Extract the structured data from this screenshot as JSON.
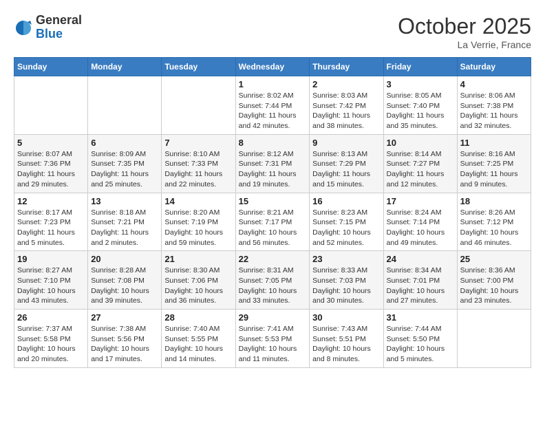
{
  "header": {
    "logo_general": "General",
    "logo_blue": "Blue",
    "month": "October 2025",
    "location": "La Verrie, France"
  },
  "weekdays": [
    "Sunday",
    "Monday",
    "Tuesday",
    "Wednesday",
    "Thursday",
    "Friday",
    "Saturday"
  ],
  "weeks": [
    [
      {
        "day": "",
        "info": ""
      },
      {
        "day": "",
        "info": ""
      },
      {
        "day": "",
        "info": ""
      },
      {
        "day": "1",
        "info": "Sunrise: 8:02 AM\nSunset: 7:44 PM\nDaylight: 11 hours and 42 minutes."
      },
      {
        "day": "2",
        "info": "Sunrise: 8:03 AM\nSunset: 7:42 PM\nDaylight: 11 hours and 38 minutes."
      },
      {
        "day": "3",
        "info": "Sunrise: 8:05 AM\nSunset: 7:40 PM\nDaylight: 11 hours and 35 minutes."
      },
      {
        "day": "4",
        "info": "Sunrise: 8:06 AM\nSunset: 7:38 PM\nDaylight: 11 hours and 32 minutes."
      }
    ],
    [
      {
        "day": "5",
        "info": "Sunrise: 8:07 AM\nSunset: 7:36 PM\nDaylight: 11 hours and 29 minutes."
      },
      {
        "day": "6",
        "info": "Sunrise: 8:09 AM\nSunset: 7:35 PM\nDaylight: 11 hours and 25 minutes."
      },
      {
        "day": "7",
        "info": "Sunrise: 8:10 AM\nSunset: 7:33 PM\nDaylight: 11 hours and 22 minutes."
      },
      {
        "day": "8",
        "info": "Sunrise: 8:12 AM\nSunset: 7:31 PM\nDaylight: 11 hours and 19 minutes."
      },
      {
        "day": "9",
        "info": "Sunrise: 8:13 AM\nSunset: 7:29 PM\nDaylight: 11 hours and 15 minutes."
      },
      {
        "day": "10",
        "info": "Sunrise: 8:14 AM\nSunset: 7:27 PM\nDaylight: 11 hours and 12 minutes."
      },
      {
        "day": "11",
        "info": "Sunrise: 8:16 AM\nSunset: 7:25 PM\nDaylight: 11 hours and 9 minutes."
      }
    ],
    [
      {
        "day": "12",
        "info": "Sunrise: 8:17 AM\nSunset: 7:23 PM\nDaylight: 11 hours and 5 minutes."
      },
      {
        "day": "13",
        "info": "Sunrise: 8:18 AM\nSunset: 7:21 PM\nDaylight: 11 hours and 2 minutes."
      },
      {
        "day": "14",
        "info": "Sunrise: 8:20 AM\nSunset: 7:19 PM\nDaylight: 10 hours and 59 minutes."
      },
      {
        "day": "15",
        "info": "Sunrise: 8:21 AM\nSunset: 7:17 PM\nDaylight: 10 hours and 56 minutes."
      },
      {
        "day": "16",
        "info": "Sunrise: 8:23 AM\nSunset: 7:15 PM\nDaylight: 10 hours and 52 minutes."
      },
      {
        "day": "17",
        "info": "Sunrise: 8:24 AM\nSunset: 7:14 PM\nDaylight: 10 hours and 49 minutes."
      },
      {
        "day": "18",
        "info": "Sunrise: 8:26 AM\nSunset: 7:12 PM\nDaylight: 10 hours and 46 minutes."
      }
    ],
    [
      {
        "day": "19",
        "info": "Sunrise: 8:27 AM\nSunset: 7:10 PM\nDaylight: 10 hours and 43 minutes."
      },
      {
        "day": "20",
        "info": "Sunrise: 8:28 AM\nSunset: 7:08 PM\nDaylight: 10 hours and 39 minutes."
      },
      {
        "day": "21",
        "info": "Sunrise: 8:30 AM\nSunset: 7:06 PM\nDaylight: 10 hours and 36 minutes."
      },
      {
        "day": "22",
        "info": "Sunrise: 8:31 AM\nSunset: 7:05 PM\nDaylight: 10 hours and 33 minutes."
      },
      {
        "day": "23",
        "info": "Sunrise: 8:33 AM\nSunset: 7:03 PM\nDaylight: 10 hours and 30 minutes."
      },
      {
        "day": "24",
        "info": "Sunrise: 8:34 AM\nSunset: 7:01 PM\nDaylight: 10 hours and 27 minutes."
      },
      {
        "day": "25",
        "info": "Sunrise: 8:36 AM\nSunset: 7:00 PM\nDaylight: 10 hours and 23 minutes."
      }
    ],
    [
      {
        "day": "26",
        "info": "Sunrise: 7:37 AM\nSunset: 5:58 PM\nDaylight: 10 hours and 20 minutes."
      },
      {
        "day": "27",
        "info": "Sunrise: 7:38 AM\nSunset: 5:56 PM\nDaylight: 10 hours and 17 minutes."
      },
      {
        "day": "28",
        "info": "Sunrise: 7:40 AM\nSunset: 5:55 PM\nDaylight: 10 hours and 14 minutes."
      },
      {
        "day": "29",
        "info": "Sunrise: 7:41 AM\nSunset: 5:53 PM\nDaylight: 10 hours and 11 minutes."
      },
      {
        "day": "30",
        "info": "Sunrise: 7:43 AM\nSunset: 5:51 PM\nDaylight: 10 hours and 8 minutes."
      },
      {
        "day": "31",
        "info": "Sunrise: 7:44 AM\nSunset: 5:50 PM\nDaylight: 10 hours and 5 minutes."
      },
      {
        "day": "",
        "info": ""
      }
    ]
  ]
}
